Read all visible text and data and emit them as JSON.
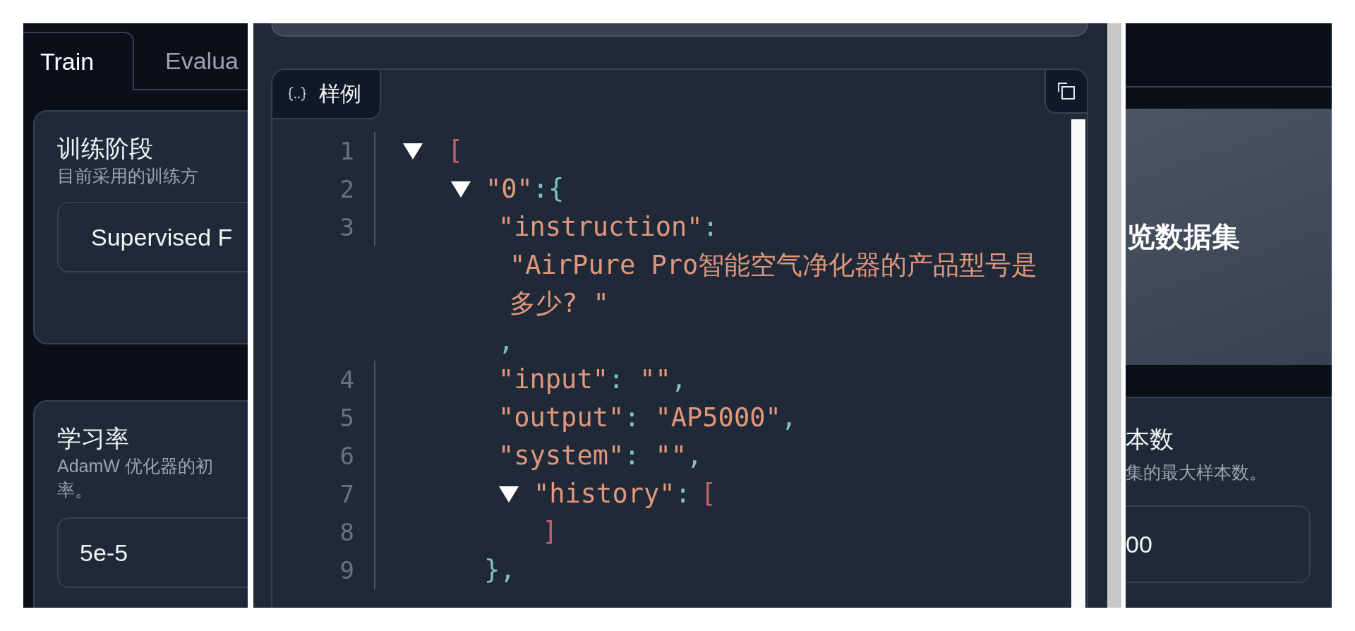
{
  "left_panel": {
    "tabs": [
      {
        "label": "Train",
        "selected": true
      },
      {
        "label": "Evalua",
        "selected": false
      }
    ],
    "cards": [
      {
        "title": "训练阶段",
        "description": [
          "目前采用的训练方"
        ],
        "kind": "dropdown",
        "value": "Supervised F"
      },
      {
        "title": "学习率",
        "description": [
          "AdamW 优化器的初",
          "率。"
        ],
        "kind": "input",
        "value": "5e-5"
      }
    ]
  },
  "modal": {
    "code_block": {
      "label": "样例",
      "tree": [
        {
          "line": "1",
          "expanded": true,
          "open": "[",
          "children": [
            {
              "line": "2",
              "expanded": true,
              "key": "\"0\"",
              "colon": ":",
              "open": "{",
              "children": [
                {
                  "line": "3",
                  "key": "\"instruction\"",
                  "colon": ":",
                  "value": "\"AirPure Pro智能空气净化器的产品型号是多少? \"",
                  "comma": ","
                },
                {
                  "line": "4",
                  "key": "\"input\"",
                  "colon": ":",
                  "value": "\"\"",
                  "comma": ","
                },
                {
                  "line": "5",
                  "key": "\"output\"",
                  "colon": ":",
                  "value": "\"AP5000\"",
                  "comma": ","
                },
                {
                  "line": "6",
                  "key": "\"system\"",
                  "colon": ":",
                  "value": "\"\"",
                  "comma": ","
                },
                {
                  "line": "7",
                  "key": "\"history\"",
                  "colon": ":",
                  "expanded": true,
                  "open": "[",
                  "close": {
                    "line": "8",
                    "text": "]"
                  }
                }
              ],
              "close": {
                "line": "9",
                "text": "},"
              }
            }
          ]
        }
      ]
    }
  },
  "right_panel": {
    "button": "览数据集",
    "card": {
      "title": "本数",
      "description": "集的最大样本数。",
      "value": "00"
    }
  }
}
